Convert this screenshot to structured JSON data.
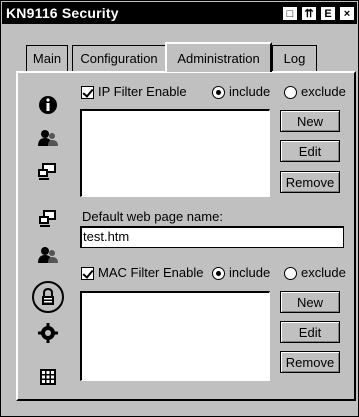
{
  "window": {
    "title": "KN9116 Security"
  },
  "titlebar_buttons": [
    "□",
    "⇈",
    "E",
    "×"
  ],
  "tabs": [
    {
      "label": "Main"
    },
    {
      "label": "Configuration"
    },
    {
      "label": "Administration"
    },
    {
      "label": "Log"
    }
  ],
  "ip_filter": {
    "label": "IP Filter Enable",
    "include_label": "include",
    "exclude_label": "exclude",
    "buttons": {
      "new": "New",
      "edit": "Edit",
      "remove": "Remove"
    }
  },
  "default_page": {
    "label": "Default web page name:",
    "value": "test.htm"
  },
  "mac_filter": {
    "label": "MAC Filter Enable",
    "include_label": "include",
    "exclude_label": "exclude",
    "buttons": {
      "new": "New",
      "edit": "Edit",
      "remove": "Remove"
    }
  },
  "sidebar_icons": [
    "info-icon",
    "users-icon",
    "computer-icon",
    "network-icon",
    "user-group-icon",
    "lock-icon",
    "gear-icon",
    "keypad-icon"
  ]
}
